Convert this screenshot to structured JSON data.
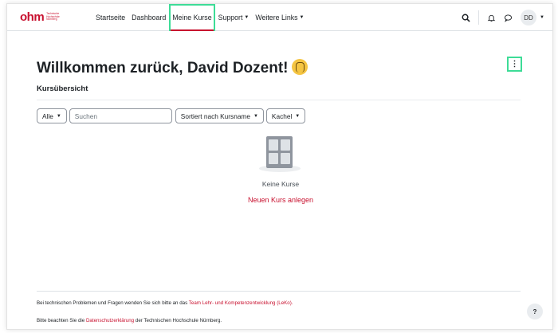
{
  "brand": {
    "logo_text": "ohm",
    "logo_sub": "Technische Hochschule Nürnberg"
  },
  "nav": {
    "items": [
      {
        "label": "Startseite"
      },
      {
        "label": "Dashboard"
      },
      {
        "label": "Meine Kurse"
      },
      {
        "label": "Support"
      },
      {
        "label": "Weitere Links"
      }
    ],
    "active": "Meine Kurse"
  },
  "user": {
    "initials": "DD"
  },
  "page": {
    "title": "Willkommen zurück, David Dozent!"
  },
  "section": {
    "title": "Kursübersicht"
  },
  "filters": {
    "grouping": "Alle",
    "search_placeholder": "Suchen",
    "sort": "Sortiert nach Kursname",
    "view": "Kachel"
  },
  "empty": {
    "text": "Keine Kurse",
    "action": "Neuen Kurs anlegen"
  },
  "footer": {
    "line1_before": "Bei technischen Problemen und Fragen wenden Sie sich bitte an das",
    "line1_link": "Team Lehr- und Kompetenzentwicklung (LeKo).",
    "line2_before": "Bitte beachten Sie die",
    "line2_link": "Datenschutzerklärung",
    "line2_after": "der Technischen Hochschule Nürnberg."
  },
  "help": {
    "label": "?"
  },
  "colors": {
    "accent": "#c8102e",
    "highlight": "#3ddc97"
  },
  "icons": [
    "search-icon",
    "bell-icon",
    "chat-icon",
    "chevron-down-icon",
    "kebab-menu-icon",
    "waving-hand-icon",
    "empty-courses-icon"
  ]
}
